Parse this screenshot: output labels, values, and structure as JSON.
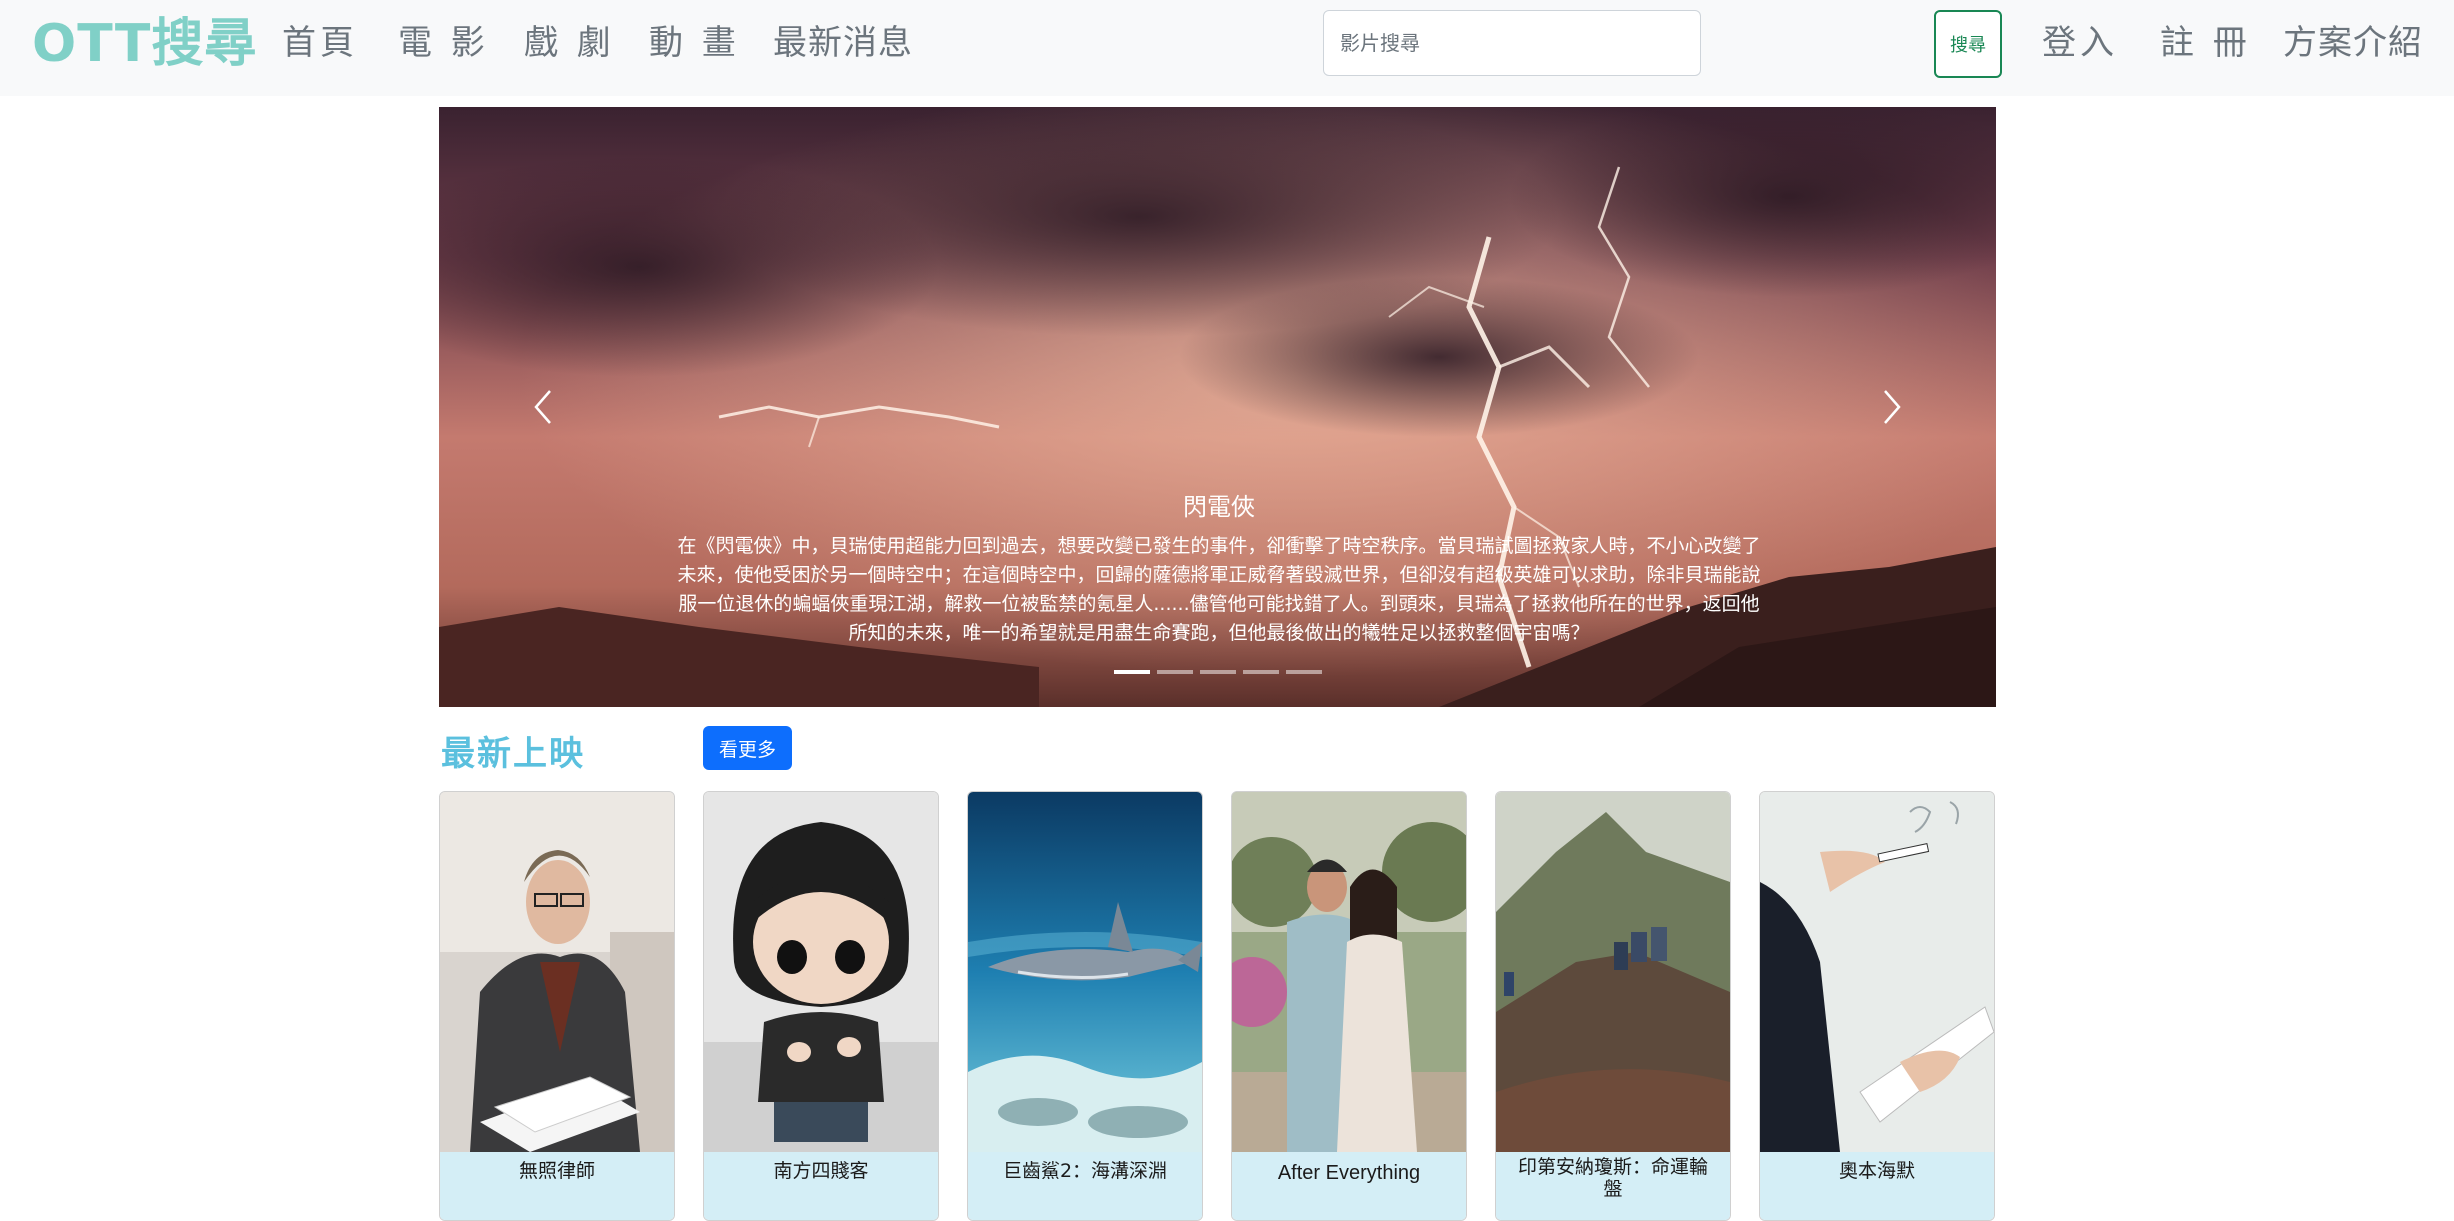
{
  "navbar": {
    "brand": "OTT搜尋",
    "links": [
      "首頁",
      "電 影",
      "戲 劇",
      "動 畫",
      "最新消息"
    ],
    "search_placeholder": "影片搜尋",
    "search_button": "搜尋",
    "login": "登入",
    "register": "註 冊",
    "plans": "方案介紹"
  },
  "carousel": {
    "title": "閃電俠",
    "description": "在《閃電俠》中，貝瑞使用超能力回到過去，想要改變已發生的事件，卻衝擊了時空秩序。當貝瑞試圖拯救家人時，不小心改變了未來，使他受困於另一個時空中；在這個時空中，回歸的薩德將軍正威脅著毀滅世界，但卻沒有超級英雄可以求助，除非貝瑞能說服一位退休的蝙蝠俠重現江湖，解救一位被監禁的氪星人......儘管他可能找錯了人。到頭來，貝瑞為了拯救他所在的世界，返回他所知的未來，唯一的希望就是用盡生命賽跑，但他最後做出的犧牲足以拯救整個宇宙嗎？",
    "slide_count": 5,
    "active_slide": 1
  },
  "latest": {
    "heading": "最新上映",
    "more_button": "看更多",
    "movies": [
      {
        "title": "無照律師"
      },
      {
        "title": "南方四賤客"
      },
      {
        "title": "巨齒鯊2：海溝深淵"
      },
      {
        "title": "After Everything"
      },
      {
        "title": "印第安納瓊斯：命運輪盤"
      },
      {
        "title": "奧本海默"
      }
    ]
  },
  "colors": {
    "brand": "#80d0c7",
    "section_heading": "#5bc0de",
    "primary_button": "#0d6efd",
    "search_button": "#198754",
    "card_caption_bg": "#d4eef6"
  }
}
